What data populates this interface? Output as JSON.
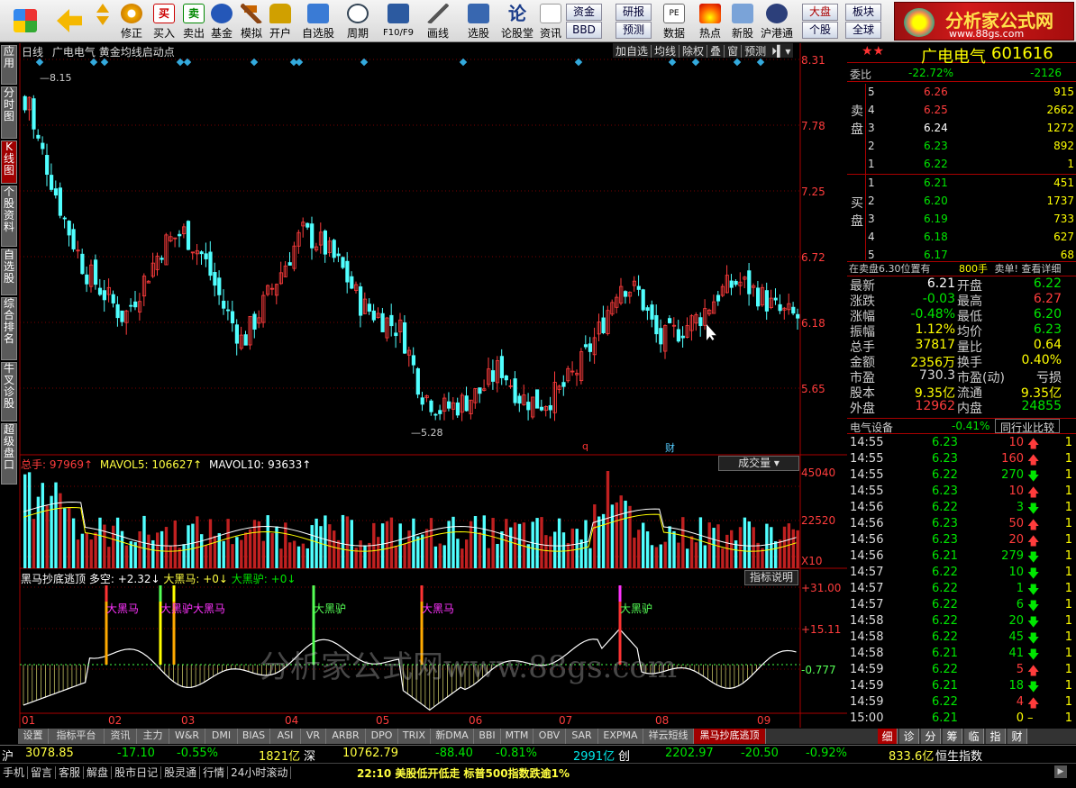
{
  "toolbar": {
    "buttons": [
      {
        "label": "",
        "icon": "app-grid-icon"
      },
      {
        "label": "",
        "icon": "back-arrow-icon"
      },
      {
        "label": "修正",
        "icon": "edit-icon"
      },
      {
        "label": "买入",
        "icon": "buy-icon"
      },
      {
        "label": "卖出",
        "icon": "sell-icon"
      },
      {
        "label": "基金",
        "icon": "fund-icon"
      },
      {
        "label": "模拟",
        "icon": "hammer-icon"
      },
      {
        "label": "开户",
        "icon": "lock-icon"
      },
      {
        "label": "自选股",
        "icon": "star-list-icon"
      },
      {
        "label": "周期",
        "icon": "clock-icon"
      },
      {
        "label": "F10/F9",
        "icon": "f10-icon"
      },
      {
        "label": "画线",
        "icon": "pen-icon"
      },
      {
        "label": "选股",
        "icon": "screen-icon"
      },
      {
        "label": "论股堂",
        "icon": "forum-icon"
      },
      {
        "label": "资讯",
        "icon": "news-icon"
      },
      {
        "label": "数据",
        "icon": "data-icon"
      },
      {
        "label": "热点",
        "icon": "hot-icon"
      },
      {
        "label": "新股",
        "icon": "ipo-icon"
      },
      {
        "label": "沪港通",
        "icon": "hk-connect-icon"
      }
    ],
    "small_buttons": [
      "资金",
      "BBD",
      "研报",
      "预测",
      "大盘",
      "个股",
      "板块",
      "全球"
    ]
  },
  "logo": {
    "title": "分析家公式网",
    "url": "www.88gs.com"
  },
  "side_tabs": [
    "应用",
    "分时图",
    "K线图",
    "个股资料",
    "自选股",
    "综合排名",
    "牛叉诊股",
    "超级盘口"
  ],
  "chart": {
    "header": {
      "period": "日线",
      "stock": "广电电气",
      "formula": "黄金均线启动点"
    },
    "header_buttons": [
      "加自选",
      "均线",
      "除权",
      "叠",
      "窗",
      "预测"
    ],
    "price_axis": [
      "8.31",
      "7.78",
      "7.25",
      "6.72",
      "6.18",
      "5.65"
    ],
    "high_label": "8.15",
    "low_label": "5.28",
    "markers": [
      "q",
      "财"
    ],
    "volume": {
      "label_total": "总手: 97969↑",
      "label_ma5": "MAVOL5: 106627↑",
      "label_ma10": "MAVOL10: 93633↑",
      "dropdown": "成交量",
      "axis": [
        "45040",
        "22520",
        "X10"
      ]
    },
    "indicator": {
      "title": "黑马抄底逃顶",
      "duokong": "多空: +2.32↓",
      "dahm": "大黑马: +0↓",
      "dahl": "大黑驴: +0↓",
      "button": "指标说明",
      "axis": [
        "+31.00",
        "+15.11",
        "-0.777"
      ],
      "signals": [
        "大黑马",
        "大黑驴大黑马",
        "大黑驴",
        "大黑马",
        "大黑驴"
      ]
    },
    "months": [
      "01",
      "02",
      "03",
      "04",
      "05",
      "06",
      "07",
      "08",
      "09"
    ],
    "watermark": "分析家公式网www.88gs.com"
  },
  "chart_data": {
    "type": "candlestick",
    "title": "广电电气 日线",
    "y_axis": [
      5.28,
      8.31
    ],
    "high": 8.15,
    "low": 5.28,
    "close_approx": [
      7.9,
      7.5,
      7.0,
      6.6,
      6.4,
      6.2,
      6.5,
      6.8,
      6.9,
      6.7,
      6.3,
      6.0,
      6.3,
      6.6,
      6.9,
      6.8,
      6.6,
      6.3,
      6.2,
      6.1,
      5.6,
      5.45,
      5.5,
      5.6,
      5.8,
      5.55,
      5.5,
      5.6,
      5.8,
      6.1,
      6.5,
      6.4,
      6.0,
      6.1,
      6.2,
      6.4,
      6.5,
      6.4,
      6.25,
      6.2
    ]
  },
  "quote": {
    "name": "广电电气",
    "code": "601616",
    "weibi_label": "委比",
    "weibi": "-22.72%",
    "weicha": "-2126",
    "sell_label": "卖盘",
    "buy_label": "买盘",
    "sell": [
      [
        "5",
        "6.26",
        "915"
      ],
      [
        "4",
        "6.25",
        "2662"
      ],
      [
        "3",
        "6.24",
        "1272"
      ],
      [
        "2",
        "6.23",
        "892"
      ],
      [
        "1",
        "6.22",
        "1"
      ]
    ],
    "buy": [
      [
        "1",
        "6.21",
        "451"
      ],
      [
        "2",
        "6.20",
        "1737"
      ],
      [
        "3",
        "6.19",
        "733"
      ],
      [
        "4",
        "6.18",
        "627"
      ],
      [
        "5",
        "6.17",
        "68"
      ]
    ],
    "note_left": "在卖盘6.30位置有",
    "note_mid": "800手",
    "note_right": "卖单! 查看详细",
    "stats": [
      [
        "最新",
        "6.21",
        "开盘",
        "6.22"
      ],
      [
        "涨跌",
        "-0.03",
        "最高",
        "6.27"
      ],
      [
        "涨幅",
        "-0.48%",
        "最低",
        "6.20"
      ],
      [
        "振幅",
        "1.12%",
        "均价",
        "6.23"
      ],
      [
        "总手",
        "37817",
        "量比",
        "0.64"
      ],
      [
        "金额",
        "2356万",
        "换手",
        "0.40%"
      ],
      [
        "市盈",
        "730.3",
        "市盈(动)",
        "亏损"
      ],
      [
        "股本",
        "9.35亿",
        "流通",
        "9.35亿"
      ],
      [
        "外盘",
        "12962",
        "内盘",
        "24855"
      ]
    ],
    "industry": "电气设备",
    "industry_pct": "-0.41%",
    "compare_btn": "同行业比较",
    "ticks": [
      [
        "14:55",
        "6.23",
        "10",
        "up"
      ],
      [
        "14:55",
        "6.23",
        "160",
        "up"
      ],
      [
        "14:55",
        "6.22",
        "270",
        "down"
      ],
      [
        "14:55",
        "6.23",
        "10",
        "up"
      ],
      [
        "14:56",
        "6.22",
        "3",
        "down"
      ],
      [
        "14:56",
        "6.23",
        "50",
        "up"
      ],
      [
        "14:56",
        "6.23",
        "20",
        "up"
      ],
      [
        "14:56",
        "6.21",
        "279",
        "down"
      ],
      [
        "14:57",
        "6.22",
        "10",
        "down"
      ],
      [
        "14:57",
        "6.22",
        "1",
        "down"
      ],
      [
        "14:57",
        "6.22",
        "6",
        "down"
      ],
      [
        "14:58",
        "6.22",
        "20",
        "down"
      ],
      [
        "14:58",
        "6.22",
        "45",
        "down"
      ],
      [
        "14:58",
        "6.21",
        "41",
        "down"
      ],
      [
        "14:59",
        "6.22",
        "5",
        "up"
      ],
      [
        "14:59",
        "6.21",
        "18",
        "down"
      ],
      [
        "14:59",
        "6.22",
        "4",
        "up"
      ],
      [
        "15:00",
        "6.21",
        "0",
        "none"
      ]
    ],
    "tabs": [
      "细",
      "诊",
      "分",
      "筹",
      "临",
      "指",
      "财"
    ]
  },
  "bottom_tabs": [
    "设置",
    "指标平台",
    "资讯",
    "主力",
    "W&R",
    "DMI",
    "BIAS",
    "ASI",
    "VR",
    "ARBR",
    "DPO",
    "TRIX",
    "新DMA",
    "BBI",
    "MTM",
    "OBV",
    "SAR",
    "EXPMA",
    "祥云短线",
    "黑马抄底逃顶"
  ],
  "status": {
    "sh_label": "沪",
    "sh_index": "3078.85",
    "sh_chg": "-17.10",
    "sh_pct": "-0.55%",
    "sh_amt": "1821亿",
    "sz_label": "深",
    "sz_index": "10762.79",
    "sz_chg": "-88.40",
    "sz_pct": "-0.81%",
    "sz_amt": "2991亿",
    "cy_label": "创",
    "cy_index": "2202.97",
    "cy_chg": "-20.50",
    "cy_pct": "-0.92%",
    "cy_amt": "833.6亿",
    "hs_label": "恒生指数",
    "menu": [
      "手机",
      "留言",
      "客服",
      "解盘",
      "股市日记",
      "股灵通",
      "行情",
      "24小时滚动"
    ],
    "news": "22:10 美股低开低走 标普500指数跌逾1%"
  },
  "colors": {
    "up": "#ff3c3c",
    "down": "#5ff",
    "bg": "#000",
    "accent": "#d21a1a"
  }
}
